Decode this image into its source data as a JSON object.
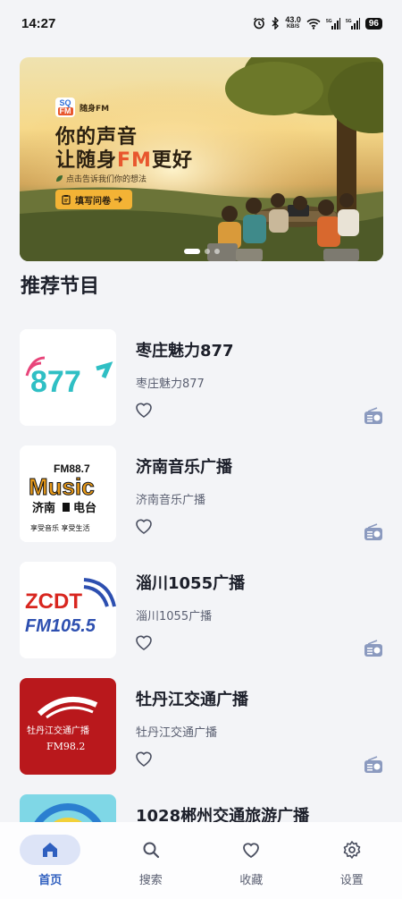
{
  "status_bar": {
    "time": "14:27",
    "net_speed_value": "43.0",
    "net_speed_unit": "KB/S",
    "battery": "96"
  },
  "banner": {
    "logo_mark_top": "SQ",
    "logo_mark_bottom": "FM",
    "logo_name": "随身FM",
    "title_line1": "你的声音",
    "title_line2_prefix": "让随身",
    "title_line2_accent": "FM",
    "title_line2_suffix": "更好",
    "subtitle": "点击告诉我们你的想法",
    "button_label": "填写问卷",
    "slide_count": 3,
    "active_slide": 1
  },
  "section_title": "推荐节目",
  "programs": [
    {
      "title": "枣庄魅力877",
      "subtitle": "枣庄魅力877",
      "cover_text": "877"
    },
    {
      "title": "济南音乐广播",
      "subtitle": "济南音乐广播",
      "cover_text_1": "FM88.7",
      "cover_text_2": "Music",
      "cover_text_3": "济南",
      "cover_text_4": "电台",
      "cover_text_5": "享受音乐  享受生活"
    },
    {
      "title": "淄川1055广播",
      "subtitle": "淄川1055广播",
      "cover_text_1": "ZCDT",
      "cover_text_2": "FM105.5"
    },
    {
      "title": "牡丹江交通广播",
      "subtitle": "牡丹江交通广播",
      "cover_text_1": "牡丹江交通广播",
      "cover_text_2": "FM98.2"
    },
    {
      "title": "1028郴州交通旅游广播",
      "subtitle": ""
    }
  ],
  "nav": {
    "home": "首页",
    "search": "搜索",
    "favorites": "收藏",
    "settings": "设置",
    "active": "home"
  },
  "colors": {
    "accent": "#2f5fbf",
    "nav_active_bg": "#dde4f7",
    "banner_button": "#f3b335",
    "brand_orange": "#e8572e"
  }
}
